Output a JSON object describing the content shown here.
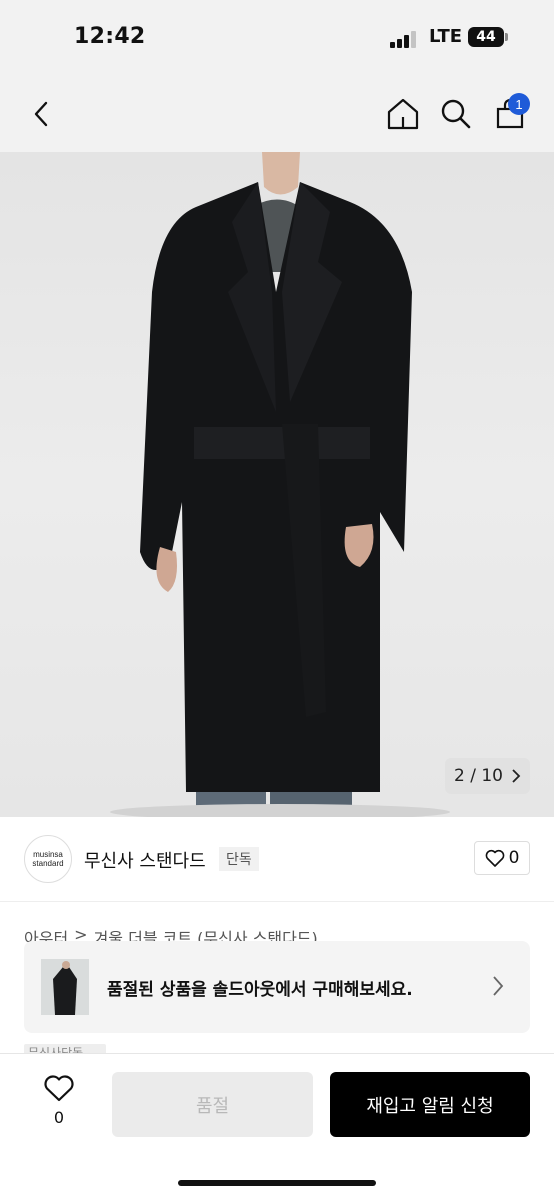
{
  "status_bar": {
    "time": "12:42",
    "network": "LTE",
    "battery": "44"
  },
  "nav": {
    "cart_count": "1"
  },
  "image_gallery": {
    "current": "2 / 10"
  },
  "brand": {
    "logo_line1": "musinsa",
    "logo_line2": "standard",
    "name": "무신사 스탠다드",
    "badge": "단독",
    "likes": "0"
  },
  "breadcrumb": {
    "category": "아우터",
    "separator": ">",
    "title": "겨울 더블 코트 (무신사 스탠다드)"
  },
  "banner": {
    "text": "품절된 상품을 솔드아웃에서 구매해보세요."
  },
  "tag_peek": {
    "text": "무신사단독"
  },
  "bottom_bar": {
    "wish_count": "0",
    "soldout_label": "품절",
    "restock_label": "재입고 알림 신청"
  }
}
